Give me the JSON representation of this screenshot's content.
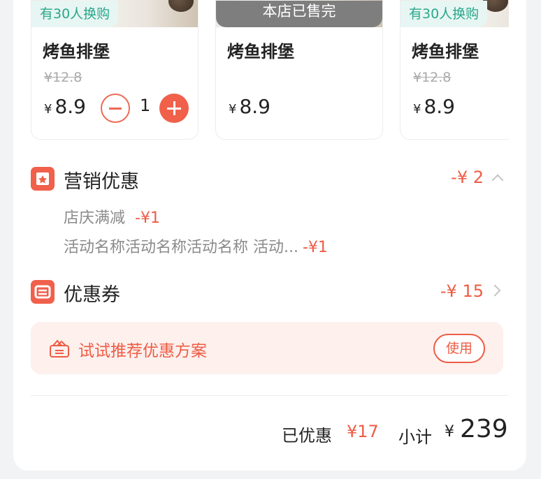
{
  "products": [
    {
      "tag": "有30人换购",
      "name": "烤鱼排堡",
      "original_price": "¥12.8",
      "currency": "¥",
      "price": "8.9",
      "quantity": "1"
    },
    {
      "soldout_label": "本店已售完",
      "name": "烤鱼排堡",
      "currency": "¥",
      "price": "8.9"
    },
    {
      "tag": "有30人换购",
      "name": "烤鱼排堡",
      "original_price": "¥12.8",
      "currency": "¥",
      "price": "8.9"
    }
  ],
  "marketing": {
    "title": "营销优惠",
    "amount": "-¥ 2",
    "items": [
      {
        "label": "店庆满减",
        "amount": "-¥1"
      },
      {
        "label": "活动名称活动名称活动名称 活动...",
        "amount": "-¥1"
      }
    ]
  },
  "coupon": {
    "title": "优惠券",
    "amount": "-¥ 15"
  },
  "recommend": {
    "text": "试试推荐优惠方案",
    "button": "使用"
  },
  "summary": {
    "saved_label": "已优惠",
    "saved_amount": "¥17",
    "subtotal_label": "小计",
    "currency": "¥",
    "subtotal": "239"
  },
  "colors": {
    "accent": "#f0604b",
    "tag_bg": "#e7f6f3",
    "tag_text": "#2aa68a"
  }
}
